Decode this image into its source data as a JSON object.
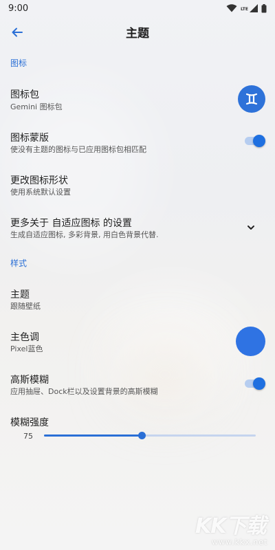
{
  "status_bar": {
    "time": "9:00",
    "network_label": "LTE",
    "icons": [
      "wifi-icon",
      "signal-icon",
      "battery-icon"
    ]
  },
  "app_bar": {
    "title": "主题",
    "back_icon": "arrow-back-icon"
  },
  "colors": {
    "accent": "#2a6fd6",
    "primary_color_swatch": "#2f73e3"
  },
  "sections": {
    "icons": {
      "header": "图标",
      "items": [
        {
          "title": "图标包",
          "subtitle": "Gemini 图标包",
          "control": "icon-pack-button",
          "icon_glyph": "♊"
        },
        {
          "title": "图标蒙版",
          "subtitle": "使没有主题的图标与已应用图标包相匹配",
          "control": "toggle",
          "checked": true
        },
        {
          "title": "更改图标形状",
          "subtitle": "使用系统默认设置"
        },
        {
          "title": "更多关于 自适应图标 的设置",
          "subtitle": "生成自适应图标, 多彩背景, 用白色背景代替.",
          "control": "chevron-down-icon"
        }
      ]
    },
    "style": {
      "header": "样式",
      "items": [
        {
          "title": "主题",
          "subtitle": "跟随壁纸"
        },
        {
          "title": "主色调",
          "subtitle": "Pixel蓝色",
          "control": "color-swatch"
        },
        {
          "title": "高斯模糊",
          "subtitle": "应用抽屉、Dock栏以及设置背景的高斯模糊",
          "control": "toggle",
          "checked": true
        },
        {
          "title": "模糊强度",
          "slider_value": "75",
          "slider_fraction": 0.46
        }
      ]
    }
  },
  "watermark": {
    "text": "KK下载",
    "url": "www.kkx.net"
  }
}
